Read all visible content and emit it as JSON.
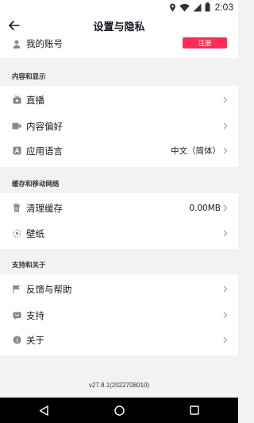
{
  "status_bar": {
    "time": "2:03"
  },
  "header": {
    "title": "设置与隐私"
  },
  "account": {
    "label": "我的账号",
    "register_label": "注册"
  },
  "sections": {
    "content": {
      "title": "内容和显示",
      "items": [
        {
          "label": "直播",
          "value": ""
        },
        {
          "label": "内容偏好",
          "value": ""
        },
        {
          "label": "应用语言",
          "value": "中文（简体）"
        }
      ]
    },
    "cache": {
      "title": "缓存和移动网络",
      "items": [
        {
          "label": "清理缓存",
          "value": "0.00MB"
        },
        {
          "label": "壁纸",
          "value": ""
        }
      ]
    },
    "support": {
      "title": "支持和关于",
      "items": [
        {
          "label": "反馈与帮助",
          "value": ""
        },
        {
          "label": "支持",
          "value": ""
        },
        {
          "label": "关于",
          "value": ""
        }
      ]
    }
  },
  "footer": {
    "version": "v27.8.1(2022708010)"
  },
  "colors": {
    "accent": "#fe2c55",
    "background": "#f2f2f2",
    "card": "#ffffff"
  }
}
